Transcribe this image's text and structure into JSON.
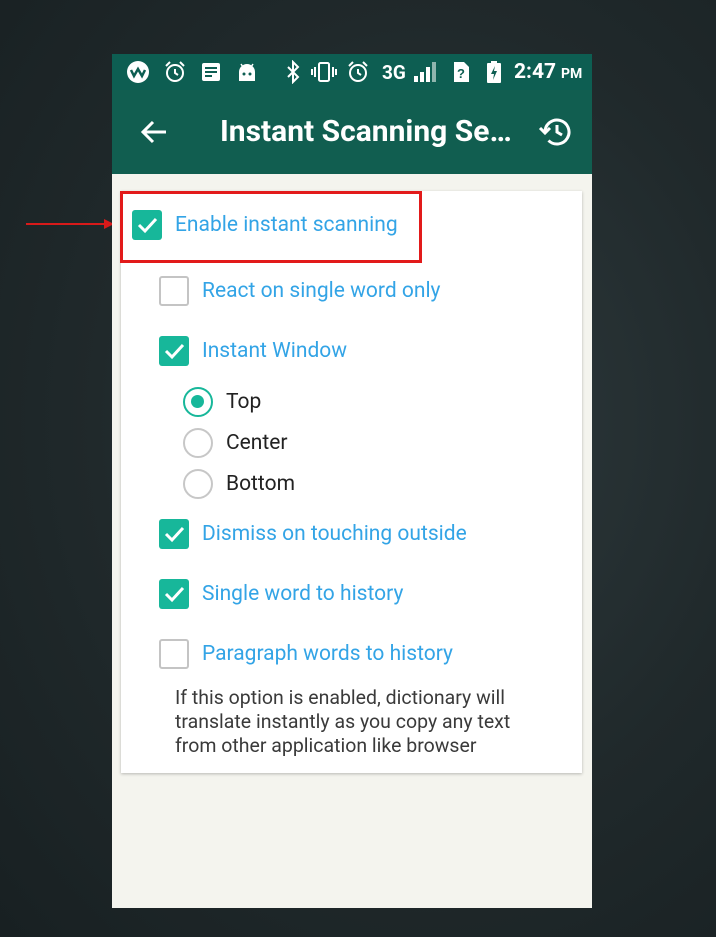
{
  "status_bar": {
    "network": "3G",
    "time": "2:47",
    "ampm": "PM",
    "icons": [
      "app-logo-icon",
      "alarm-icon",
      "notes-icon",
      "android-icon",
      "bluetooth-icon",
      "vibrate-icon",
      "alarm-icon",
      "signal-icon",
      "no-sim-icon",
      "battery-icon"
    ]
  },
  "toolbar": {
    "title": "Instant Scanning Se…",
    "back_icon": "arrow-back-icon",
    "history_icon": "history-icon"
  },
  "settings": {
    "enable_instant_scanning": {
      "label": "Enable instant scanning",
      "checked": true
    },
    "react_single_word": {
      "label": "React on single word only",
      "checked": false
    },
    "instant_window": {
      "label": "Instant Window",
      "checked": true
    },
    "window_position": {
      "options": [
        "Top",
        "Center",
        "Bottom"
      ],
      "selected": "Top"
    },
    "dismiss_outside": {
      "label": "Dismiss on touching outside",
      "checked": true
    },
    "single_word_history": {
      "label": "Single word to history",
      "checked": true
    },
    "paragraph_history": {
      "label": "Paragraph words to history",
      "checked": false
    },
    "help_text": "If this option is enabled, dictionary will translate instantly as you copy any text from other application like browser"
  },
  "colors": {
    "toolbar": "#115e50",
    "status_bar": "#0d5e52",
    "accent": "#17b79a",
    "label": "#33a4e6",
    "annotation": "#e21a1a"
  }
}
